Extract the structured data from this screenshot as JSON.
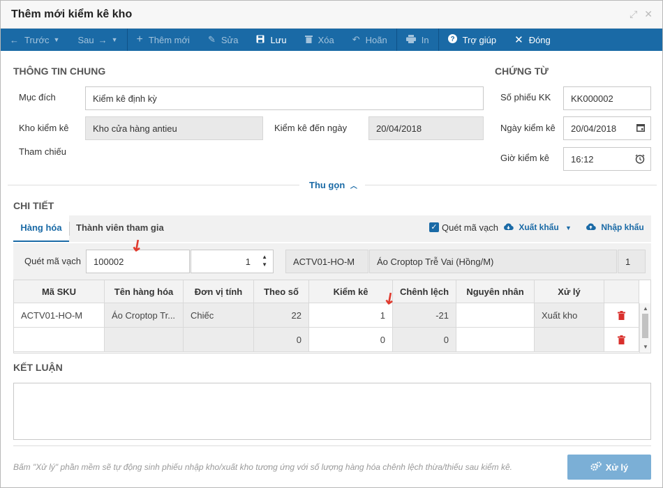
{
  "window": {
    "title": "Thêm mới kiểm kê kho"
  },
  "toolbar": {
    "prev": "Trước",
    "next": "Sau",
    "add": "Thêm mới",
    "edit": "Sửa",
    "save": "Lưu",
    "delete": "Xóa",
    "undo": "Hoãn",
    "print": "In",
    "help": "Trợ giúp",
    "close": "Đóng"
  },
  "general": {
    "section_title": "THÔNG TIN CHUNG",
    "purpose_label": "Mục đích",
    "purpose_value": "Kiểm kê định kỳ",
    "warehouse_label": "Kho kiểm kê",
    "warehouse_value": "Kho cửa hàng antieu",
    "until_label": "Kiểm kê đến ngày",
    "until_value": "20/04/2018",
    "reference_label": "Tham chiếu"
  },
  "voucher": {
    "section_title": "CHỨNG TỪ",
    "number_label": "Số phiếu KK",
    "number_value": "KK000002",
    "date_label": "Ngày kiểm kê",
    "date_value": "20/04/2018",
    "time_label": "Giờ kiểm kê",
    "time_value": "16:12"
  },
  "collapse_label": "Thu gọn",
  "detail": {
    "section_title": "CHI TIẾT",
    "tabs": [
      "Hàng hóa",
      "Thành viên tham gia"
    ],
    "barcode_toggle": "Quét mã vạch",
    "export_label": "Xuất khẩu",
    "import_label": "Nhập khẩu",
    "scan": {
      "label": "Quét mã vạch",
      "code": "100002",
      "quantity": "1",
      "sku": "ACTV01-HO-M",
      "name": "Áo Croptop Trễ Vai (Hồng/M)",
      "count": "1"
    },
    "columns": [
      "Mã SKU",
      "Tên hàng hóa",
      "Đơn vị tính",
      "Theo số",
      "Kiểm kê",
      "Chênh lệch",
      "Nguyên nhân",
      "Xử lý"
    ],
    "rows": [
      {
        "sku": "ACTV01-HO-M",
        "name": "Áo Croptop Tr...",
        "unit": "Chiếc",
        "book": "22",
        "counted": "1",
        "diff": "-21",
        "reason": "",
        "action": "Xuất kho"
      },
      {
        "sku": "",
        "name": "",
        "unit": "",
        "book": "0",
        "counted": "0",
        "diff": "0",
        "reason": "",
        "action": ""
      }
    ]
  },
  "conclusion": {
    "section_title": "KẾT LUẬN"
  },
  "footer": {
    "note": "Bấm \"Xử lý\" phần mềm sẽ tự động sinh phiếu nhập kho/xuất kho tương ứng với số lượng hàng hóa chênh lệch thừa/thiếu sau kiểm kê.",
    "process_label": "Xử lý"
  },
  "colors": {
    "primary": "#1a6aa6",
    "danger": "#d9302c",
    "process_button": "#7bafd6"
  }
}
